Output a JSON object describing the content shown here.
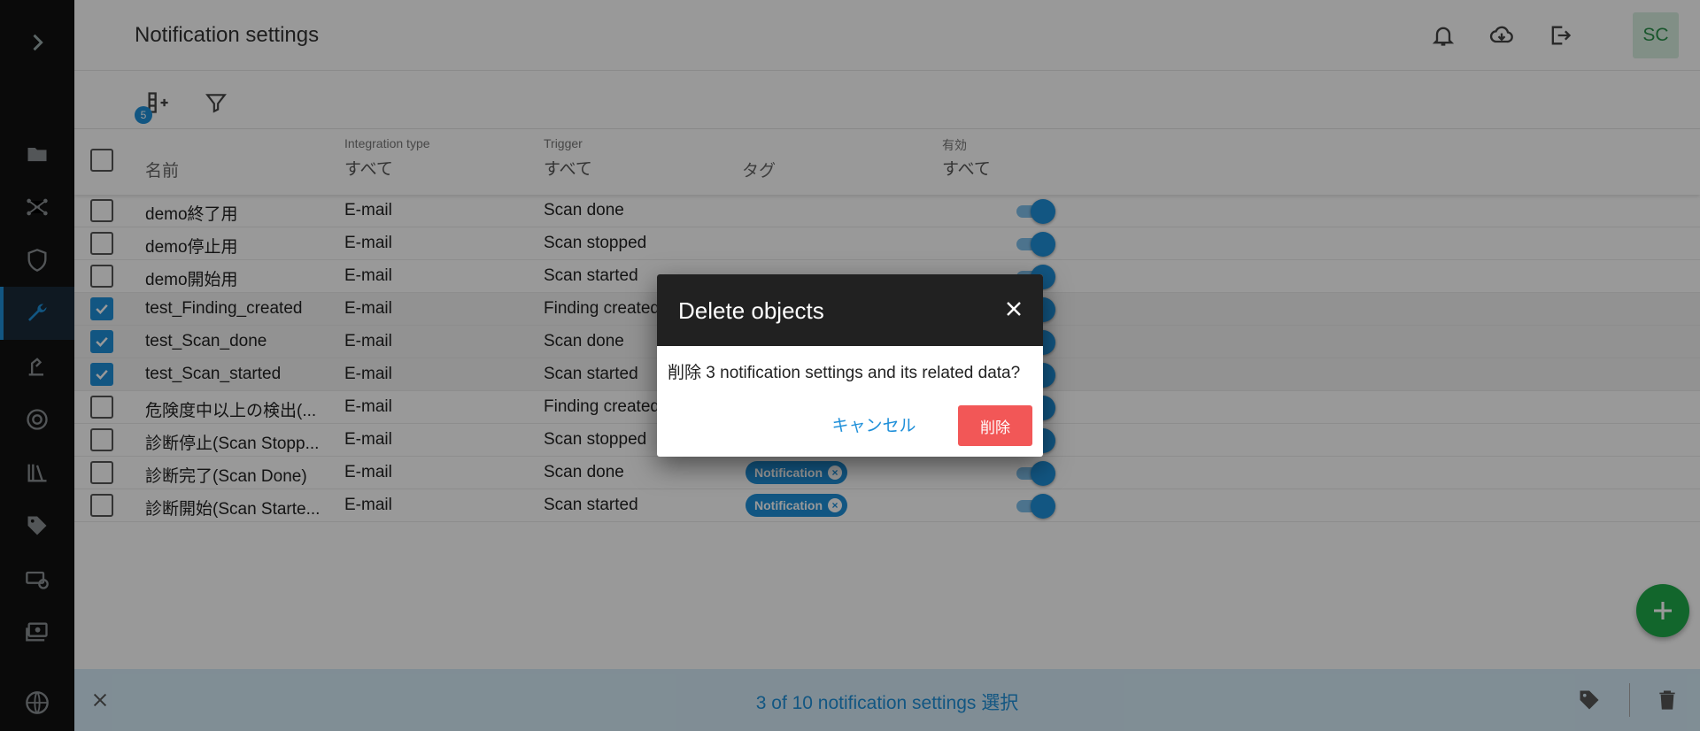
{
  "header": {
    "title": "Notification settings",
    "avatar": "SC"
  },
  "toolbar": {
    "column_count_badge": "5"
  },
  "table": {
    "columns": {
      "name": {
        "label": "名前"
      },
      "integration_type": {
        "small": "Integration type",
        "filter": "すべて"
      },
      "trigger": {
        "small": "Trigger",
        "filter": "すべて"
      },
      "tags": {
        "label": "タグ"
      },
      "enabled": {
        "small": "有効",
        "filter": "すべて"
      }
    },
    "rows": [
      {
        "name": "demo終了用",
        "integration_type": "E-mail",
        "trigger": "Scan done",
        "tag": "",
        "checked": false,
        "enabled": true
      },
      {
        "name": "demo停止用",
        "integration_type": "E-mail",
        "trigger": "Scan stopped",
        "tag": "",
        "checked": false,
        "enabled": true
      },
      {
        "name": "demo開始用",
        "integration_type": "E-mail",
        "trigger": "Scan started",
        "tag": "",
        "checked": false,
        "enabled": true
      },
      {
        "name": "test_Finding_created",
        "integration_type": "E-mail",
        "trigger": "Finding created",
        "tag": "",
        "checked": true,
        "enabled": true
      },
      {
        "name": "test_Scan_done",
        "integration_type": "E-mail",
        "trigger": "Scan done",
        "tag": "",
        "checked": true,
        "enabled": true
      },
      {
        "name": "test_Scan_started",
        "integration_type": "E-mail",
        "trigger": "Scan started",
        "tag": "",
        "checked": true,
        "enabled": true
      },
      {
        "name": "危険度中以上の検出(...",
        "integration_type": "E-mail",
        "trigger": "Finding created",
        "tag": "",
        "checked": false,
        "enabled": true
      },
      {
        "name": "診断停止(Scan Stopp...",
        "integration_type": "E-mail",
        "trigger": "Scan stopped",
        "tag": "",
        "checked": false,
        "enabled": true
      },
      {
        "name": "診断完了(Scan Done)",
        "integration_type": "E-mail",
        "trigger": "Scan done",
        "tag": "Notification",
        "checked": false,
        "enabled": true
      },
      {
        "name": "診断開始(Scan Starte...",
        "integration_type": "E-mail",
        "trigger": "Scan started",
        "tag": "Notification",
        "checked": false,
        "enabled": true
      }
    ]
  },
  "selection_bar": {
    "text": "3 of 10 notification settings 選択"
  },
  "dialog": {
    "title": "Delete objects",
    "message": "削除 3 notification settings and its related data?",
    "cancel_label": "キャンセル",
    "delete_label": "削除"
  },
  "colors": {
    "accent": "#1e8fd9",
    "danger": "#f25757",
    "fab": "#1faa4a",
    "sidebar": "#111111"
  }
}
